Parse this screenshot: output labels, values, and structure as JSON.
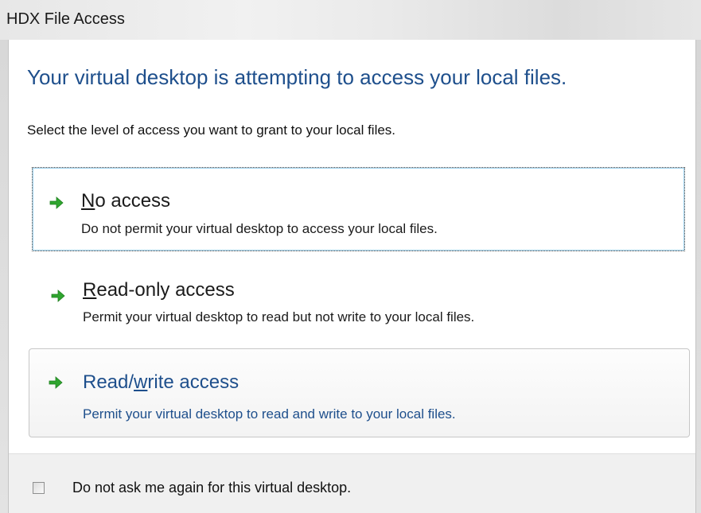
{
  "window": {
    "title": "HDX File Access"
  },
  "dialog": {
    "heading": "Your virtual desktop is attempting to access your local files.",
    "instruction": "Select the level of access you want to grant to your local files."
  },
  "options": [
    {
      "title_prefix": "",
      "title_access_key": "N",
      "title_suffix": "o access",
      "description": "Do not permit your virtual desktop to access your local files.",
      "icon": "green-arrow-icon"
    },
    {
      "title_prefix": "",
      "title_access_key": "R",
      "title_suffix": "ead-only access",
      "description": "Permit your virtual desktop to read but not write to your local files.",
      "icon": "green-arrow-icon"
    },
    {
      "title_prefix": "Read/",
      "title_access_key": "w",
      "title_suffix": "rite access",
      "description": "Permit your virtual desktop to read and write to your local files.",
      "icon": "green-arrow-icon"
    }
  ],
  "footer": {
    "checkbox_label": "Do not ask me again for this virtual desktop.",
    "checkbox_checked": false
  },
  "colors": {
    "heading": "#1e4f8c",
    "hover_link": "#1e4f8c",
    "arrow": "#2fa52f",
    "footer_background": "#f0f0f0"
  }
}
